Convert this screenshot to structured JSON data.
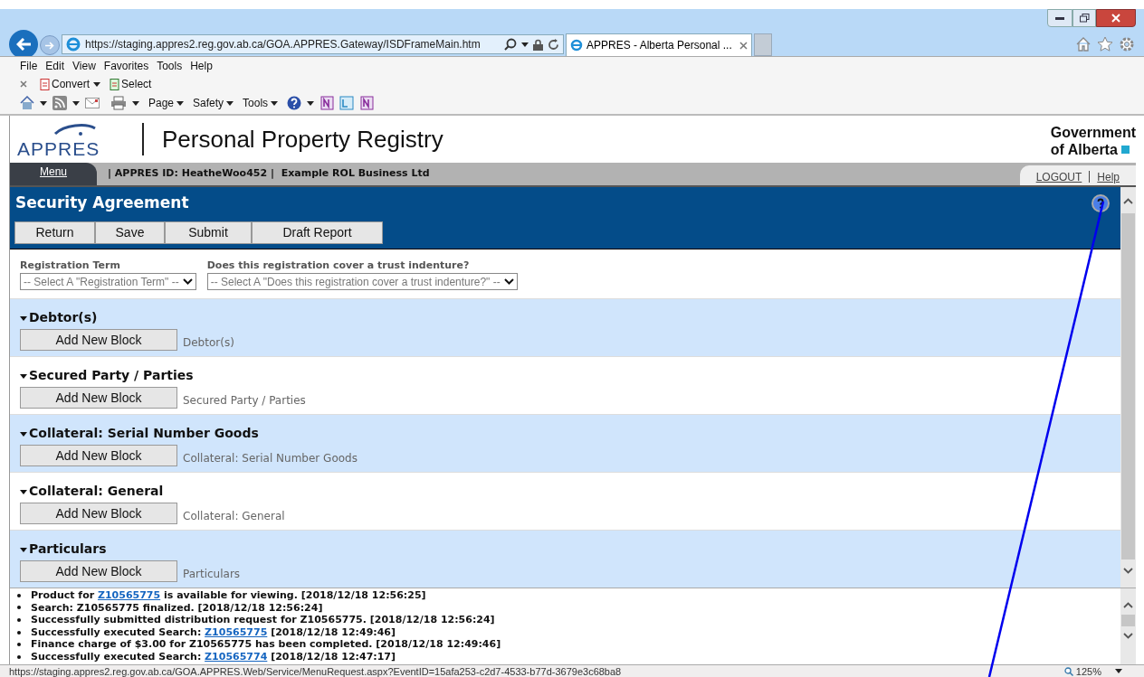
{
  "browser": {
    "address": "https://staging.appres2.reg.gov.ab.ca/GOA.APPRES.Gateway/ISDFrameMain.htm",
    "tabs": [
      {
        "title": "APPRES - Alberta Personal ...",
        "selected": true
      }
    ],
    "menu": [
      "File",
      "Edit",
      "View",
      "Favorites",
      "Tools",
      "Help"
    ],
    "command_bar": [
      "Convert",
      "Select"
    ],
    "toolbar": [
      "Page",
      "Safety",
      "Tools"
    ],
    "status_url": "https://staging.appres2.reg.gov.ab.ca/GOA.APPRES.Web/Service/MenuRequest.aspx?EventID=15afa253-c2d7-4533-b77d-3679e3c68ba8",
    "zoom": "125%"
  },
  "header": {
    "logo": "APPRES",
    "title": "Personal Property Registry",
    "government": [
      "Government",
      "of Alberta"
    ]
  },
  "nav": {
    "menu": "Menu",
    "user": "| APPRES ID: HeatheWoo452 |  Example ROL Business Ltd",
    "links": [
      "LOGOUT",
      "Help"
    ]
  },
  "form": {
    "title": "Security Agreement",
    "buttons": [
      "Return",
      "Save",
      "Submit",
      "Draft Report"
    ],
    "fields": [
      {
        "label": "Registration Term",
        "value": "-- Select A \"Registration Term\" --"
      },
      {
        "label": "Does this registration cover a trust indenture?",
        "value": "-- Select A \"Does this registration cover a trust indenture?\" --"
      }
    ],
    "sections": [
      {
        "title": "Debtor(s)",
        "expanded": true,
        "button": "Add New Block",
        "caption": "Debtor(s)"
      },
      {
        "title": "Secured Party / Parties",
        "expanded": true,
        "button": "Add New Block",
        "caption": "Secured Party / Parties"
      },
      {
        "title": "Collateral: Serial Number Goods",
        "expanded": true,
        "button": "Add New Block",
        "caption": "Collateral: Serial Number Goods"
      },
      {
        "title": "Collateral: General",
        "expanded": true,
        "button": "Add New Block",
        "caption": "Collateral: General"
      },
      {
        "title": "Particulars",
        "expanded": true,
        "button": "Add New Block",
        "caption": "Particulars"
      }
    ]
  },
  "messages": [
    [
      {
        "text": "Product for "
      },
      {
        "link": "Z10565775"
      },
      {
        "text": " is available for viewing. [2018/12/18 12:56:25]"
      }
    ],
    [
      {
        "text": "Search: Z10565775 finalized. [2018/12/18 12:56:24]"
      }
    ],
    [
      {
        "text": "Successfully submitted distribution request for Z10565775. [2018/12/18 12:56:24]"
      }
    ],
    [
      {
        "text": "Successfully executed Search: "
      },
      {
        "link": "Z10565775"
      },
      {
        "text": " [2018/12/18 12:49:46]"
      }
    ],
    [
      {
        "text": "Finance charge of $3.00 for Z10565775 has been completed. [2018/12/18 12:49:46]"
      }
    ],
    [
      {
        "text": "Successfully executed Search: "
      },
      {
        "link": "Z10565774"
      },
      {
        "text": " [2018/12/18 12:47:17]"
      }
    ]
  ]
}
